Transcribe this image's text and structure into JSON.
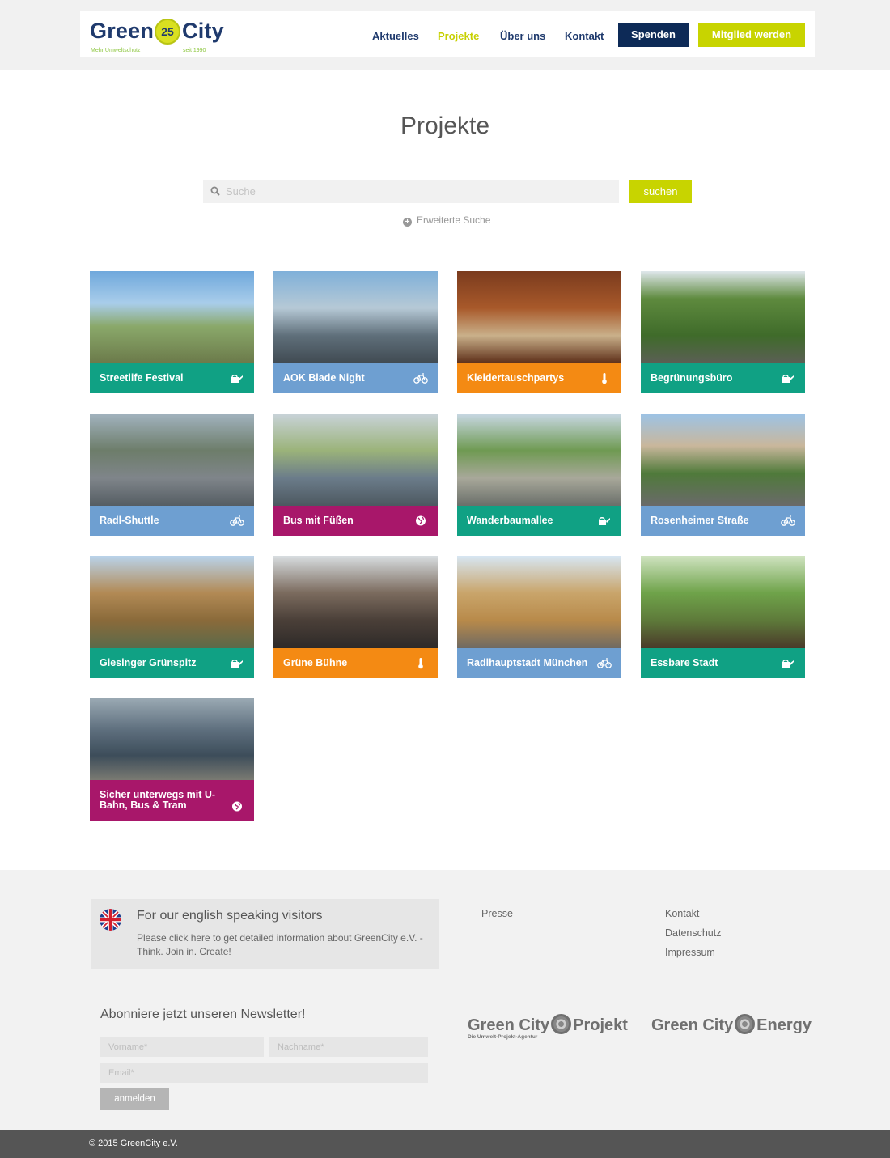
{
  "header": {
    "logo": {
      "word1": "Green",
      "badge": "25",
      "word2": "City",
      "tagline": "Mehr Umweltschutz",
      "since": "seit 1990"
    },
    "nav": [
      {
        "label": "Aktuelles",
        "active": false
      },
      {
        "label": "Projekte",
        "active": true
      },
      {
        "label": "Über uns",
        "active": false
      },
      {
        "label": "Kontakt",
        "active": false
      }
    ],
    "spenden_label": "Spenden",
    "mitglied_label": "Mitglied werden"
  },
  "colors": {
    "navy": "#0d2a57",
    "lime": "#c8d400",
    "teal": "#10a184",
    "blue": "#6e9fd1",
    "orange": "#f48a13",
    "magenta": "#a8176a"
  },
  "main": {
    "title": "Projekte",
    "search": {
      "placeholder": "Suche",
      "button_label": "suchen",
      "advanced_label": "Erweiterte Suche",
      "search_icon": "search-icon"
    }
  },
  "projects": [
    {
      "title": "Streetlife Festival",
      "color": "#10a184",
      "icon": "watering-can-icon"
    },
    {
      "title": "AOK Blade Night",
      "color": "#6e9fd1",
      "icon": "bicycle-icon"
    },
    {
      "title": "Kleidertauschpartys",
      "color": "#f48a13",
      "icon": "thermometer-icon"
    },
    {
      "title": "Begrünungsbüro",
      "color": "#10a184",
      "icon": "watering-can-icon"
    },
    {
      "title": "Radl-Shuttle",
      "color": "#6e9fd1",
      "icon": "bicycle-icon"
    },
    {
      "title": "Bus mit Füßen",
      "color": "#a8176a",
      "icon": "globe-icon"
    },
    {
      "title": "Wanderbaumallee",
      "color": "#10a184",
      "icon": "watering-can-icon"
    },
    {
      "title": "Rosenheimer Straße",
      "color": "#6e9fd1",
      "icon": "bicycle-icon"
    },
    {
      "title": "Giesinger Grünspitz",
      "color": "#10a184",
      "icon": "watering-can-icon"
    },
    {
      "title": "Grüne Bühne",
      "color": "#f48a13",
      "icon": "thermometer-icon"
    },
    {
      "title": "Radlhauptstadt München",
      "color": "#6e9fd1",
      "icon": "bicycle-icon"
    },
    {
      "title": "Essbare Stadt",
      "color": "#10a184",
      "icon": "watering-can-icon"
    },
    {
      "title": "Sicher unterwegs mit U-Bahn, Bus & Tram",
      "color": "#a8176a",
      "icon": "globe-icon"
    }
  ],
  "footer": {
    "english": {
      "title": "For our english speaking visitors",
      "text": "Please click here to get detailed information about GreenCity e.V. - Think. Join in. Create!",
      "flag_icon": "uk-flag-icon"
    },
    "links_col1": [
      "Presse"
    ],
    "links_col2": [
      "Kontakt",
      "Datenschutz",
      "Impressum"
    ],
    "newsletter": {
      "title": "Abonniere jetzt unseren Newsletter!",
      "firstname_placeholder": "Vorname*",
      "lastname_placeholder": "Nachname*",
      "email_placeholder": "Email*",
      "button_label": "anmelden"
    },
    "partner_logos": [
      {
        "word1": "Green City",
        "word2": "Projekt",
        "sub": "Die Umwelt-Projekt-Agentur"
      },
      {
        "word1": "Green City",
        "word2": "Energy"
      }
    ],
    "copyright": "© 2015 GreenCity e.V."
  }
}
